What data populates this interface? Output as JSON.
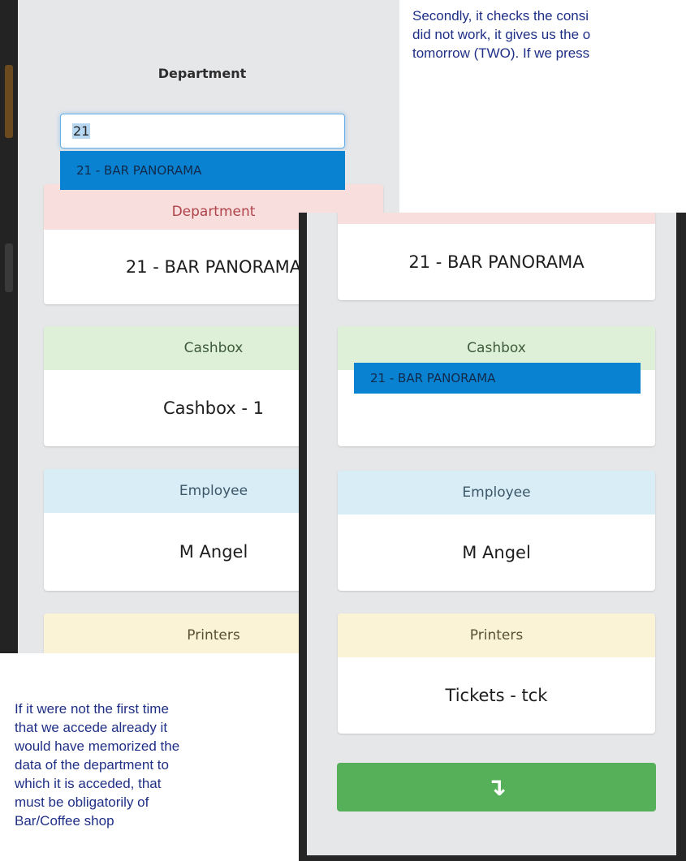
{
  "doc": {
    "intro_lines": [
      "Secondly, it checks the consi",
      "did not work, it gives us the o",
      "tomorrow (TWO). If we press"
    ],
    "note_lines": [
      "If it were not the first time",
      "that we accede already it",
      "would have memorized the",
      "data of the department to",
      "which it is acceded, that",
      "must be obligatorily of",
      "Bar/Coffee shop"
    ]
  },
  "left_screen": {
    "department_label": "Department",
    "search_value": "21",
    "dropdown_option": "21 - BAR PANORAMA",
    "department_card": {
      "heading": "Department",
      "value": "21 - BAR PANORAMA"
    },
    "cashbox_card": {
      "heading": "Cashbox",
      "value": "Cashbox - 1"
    },
    "employee_card": {
      "heading": "Employee",
      "value": "M Angel"
    },
    "printers_card": {
      "heading": "Printers"
    }
  },
  "right_screen": {
    "department_card": {
      "value": "21 - BAR PANORAMA"
    },
    "cashbox_card": {
      "heading": "Cashbox",
      "dropdown_option": "21 - BAR PANORAMA"
    },
    "employee_card": {
      "heading": "Employee",
      "value": "M Angel"
    },
    "printers_card": {
      "heading": "Printers",
      "value": "Tickets - tck"
    },
    "proceed_button": {
      "icon": "arrow-down-icon",
      "glyph": "↴"
    }
  },
  "colors": {
    "doc_text": "#1f2f86",
    "selected_option": "#0a82d2",
    "proceed_button": "#56b05a",
    "department_head": "#f9dede",
    "cashbox_head": "#dff0d8",
    "employee_head": "#d9edf7",
    "printers_head": "#fbf3d5"
  }
}
